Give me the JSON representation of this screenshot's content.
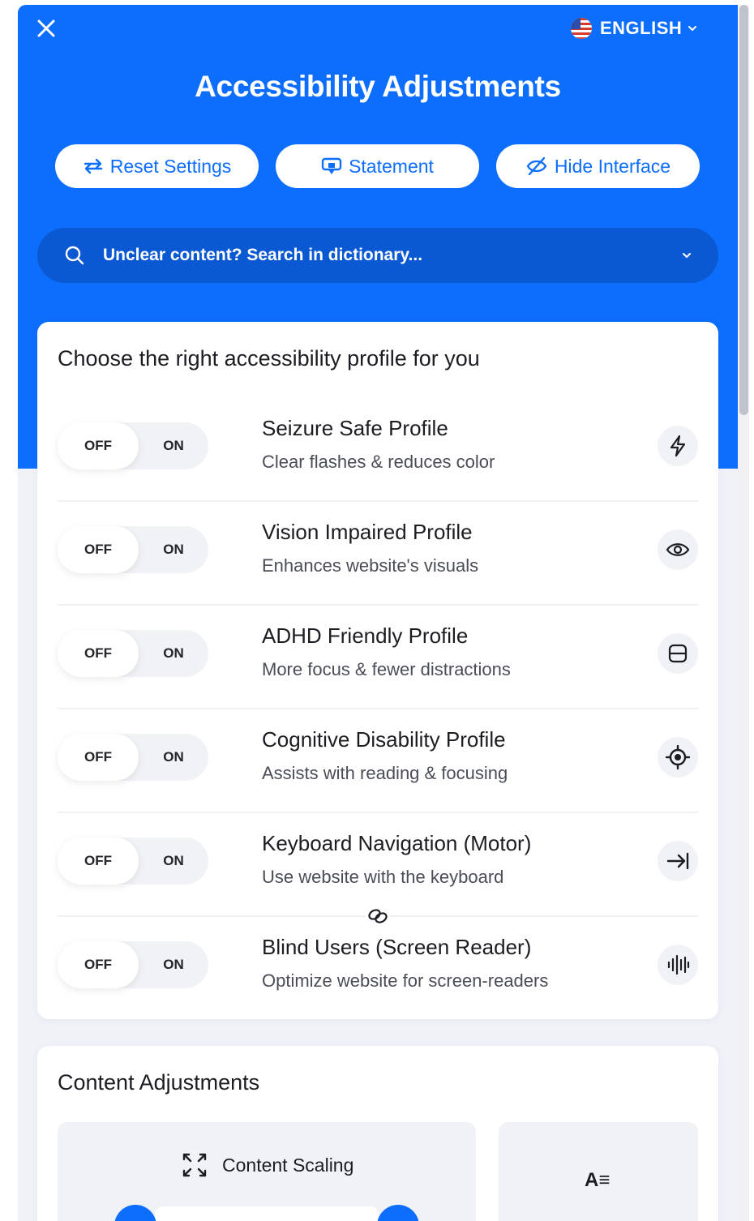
{
  "header": {
    "language_label": "ENGLISH",
    "title": "Accessibility Adjustments",
    "buttons": {
      "reset": "Reset Settings",
      "statement": "Statement",
      "hide": "Hide Interface"
    },
    "search_placeholder": "Unclear content? Search in dictionary..."
  },
  "profiles": {
    "heading": "Choose the right accessibility profile for you",
    "off_label": "OFF",
    "on_label": "ON",
    "items": [
      {
        "name": "Seizure Safe Profile",
        "desc": "Clear flashes & reduces color",
        "icon": "lightning-icon"
      },
      {
        "name": "Vision Impaired Profile",
        "desc": "Enhances website's visuals",
        "icon": "eye-icon"
      },
      {
        "name": "ADHD Friendly Profile",
        "desc": "More focus & fewer distractions",
        "icon": "focus-frame-icon"
      },
      {
        "name": "Cognitive Disability Profile",
        "desc": "Assists with reading & focusing",
        "icon": "target-icon"
      },
      {
        "name": "Keyboard Navigation (Motor)",
        "desc": "Use website with the keyboard",
        "icon": "arrow-to-bar-icon"
      },
      {
        "name": "Blind Users (Screen Reader)",
        "desc": "Optimize website for screen-readers",
        "icon": "audio-wave-icon"
      }
    ]
  },
  "content_adjustments": {
    "heading": "Content Adjustments",
    "scaling_label": "Content Scaling"
  },
  "colors": {
    "accent": "#0d6efd",
    "search_bg": "#0b58d3",
    "panel_bg": "#f1f2f8"
  }
}
